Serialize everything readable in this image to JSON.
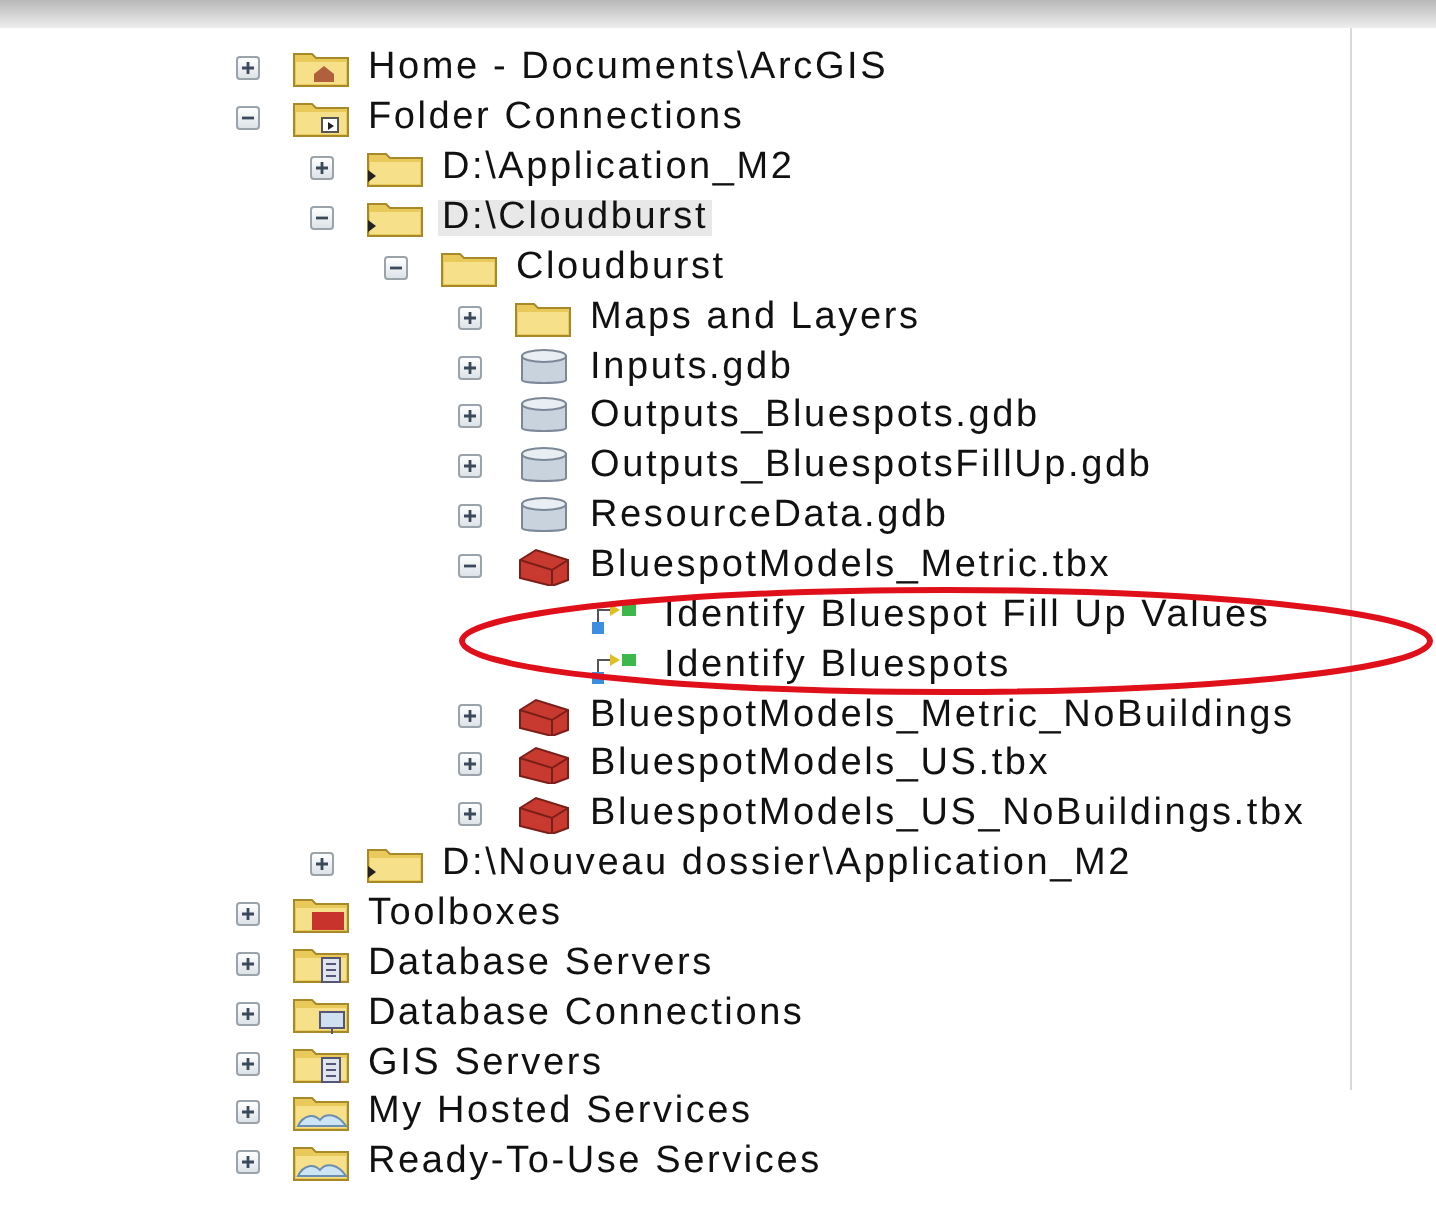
{
  "tree": [
    {
      "label": "Home - Documents\\ArcGIS",
      "kind": "home",
      "expanded": false,
      "selected": false
    },
    {
      "label": "Folder Connections",
      "kind": "connections",
      "expanded": true,
      "selected": false,
      "children": [
        {
          "label": "D:\\Application_M2",
          "kind": "linked-folder",
          "expanded": false,
          "selected": false
        },
        {
          "label": "D:\\Cloudburst",
          "kind": "linked-folder",
          "expanded": true,
          "selected": true,
          "children": [
            {
              "label": "Cloudburst",
              "kind": "folder",
              "expanded": true,
              "selected": false,
              "children": [
                {
                  "label": "Maps and Layers",
                  "kind": "folder",
                  "expanded": false,
                  "selected": false
                },
                {
                  "label": "Inputs.gdb",
                  "kind": "database",
                  "expanded": false,
                  "selected": false
                },
                {
                  "label": "Outputs_Bluespots.gdb",
                  "kind": "database",
                  "expanded": false,
                  "selected": false
                },
                {
                  "label": "Outputs_BluespotsFillUp.gdb",
                  "kind": "database",
                  "expanded": false,
                  "selected": false
                },
                {
                  "label": "ResourceData.gdb",
                  "kind": "database",
                  "expanded": false,
                  "selected": false
                },
                {
                  "label": "BluespotModels_Metric.tbx",
                  "kind": "toolbox",
                  "expanded": true,
                  "selected": false,
                  "children": [
                    {
                      "label": "Identify Bluespot Fill Up Values",
                      "kind": "model",
                      "selected": false
                    },
                    {
                      "label": "Identify Bluespots",
                      "kind": "model",
                      "selected": false
                    }
                  ]
                },
                {
                  "label": "BluespotModels_Metric_NoBuildings",
                  "kind": "toolbox",
                  "expanded": false,
                  "selected": false
                },
                {
                  "label": "BluespotModels_US.tbx",
                  "kind": "toolbox",
                  "expanded": false,
                  "selected": false
                },
                {
                  "label": "BluespotModels_US_NoBuildings.tbx",
                  "kind": "toolbox",
                  "expanded": false,
                  "selected": false
                }
              ]
            }
          ]
        },
        {
          "label": "D:\\Nouveau dossier\\Application_M2",
          "kind": "linked-folder",
          "expanded": false,
          "selected": false
        }
      ]
    },
    {
      "label": "Toolboxes",
      "kind": "toolboxes",
      "expanded": false,
      "selected": false
    },
    {
      "label": "Database Servers",
      "kind": "servers",
      "expanded": false,
      "selected": false
    },
    {
      "label": "Database Connections",
      "kind": "db-connections",
      "expanded": false,
      "selected": false
    },
    {
      "label": "GIS Servers",
      "kind": "servers",
      "expanded": false,
      "selected": false
    },
    {
      "label": "My Hosted Services",
      "kind": "cloud",
      "expanded": false,
      "selected": false
    },
    {
      "label": "Ready-To-Use Services",
      "kind": "cloud",
      "expanded": false,
      "selected": false
    }
  ]
}
